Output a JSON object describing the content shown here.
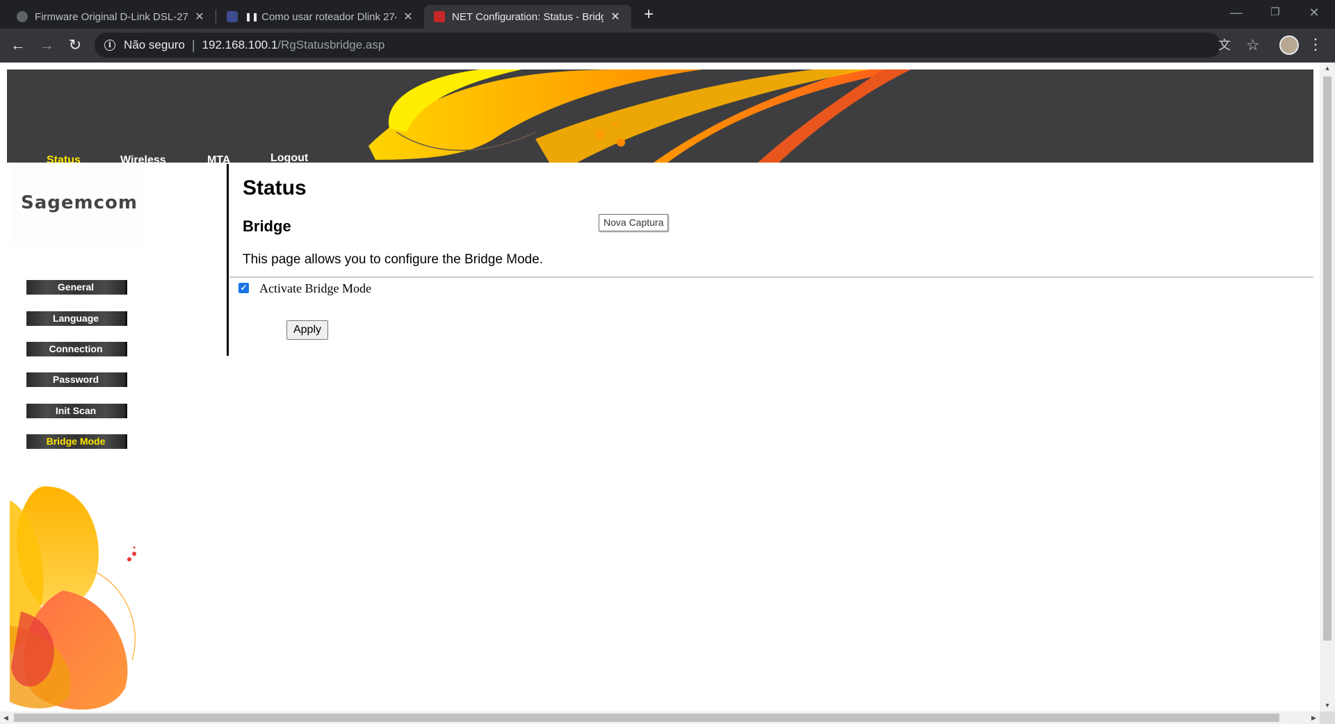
{
  "browser": {
    "tabs": [
      {
        "title": "Firmware Original D-Link DSL-27",
        "active": false
      },
      {
        "title": "Como usar roteador Dlink 274",
        "active": false
      },
      {
        "title": "NET Configuration: Status - Bridg",
        "active": true
      }
    ],
    "new_tab": "+",
    "window": {
      "minimize": "—",
      "restore": "❐",
      "close": "✕"
    },
    "nav": {
      "back": "←",
      "forward": "→",
      "reload": "↻"
    },
    "security_label": "Não seguro",
    "url_host": "192.168.100.1",
    "url_path": "/RgStatusbridge.asp",
    "translate_icon": "文",
    "bookmark_icon": "☆",
    "menu_icon": "⋮"
  },
  "topnav": [
    "Status",
    "Wireless",
    "MTA",
    "Logout"
  ],
  "logo": "Sagemcom",
  "sidebar": [
    "General",
    "Language",
    "Connection",
    "Password",
    "Init Scan",
    "Bridge Mode"
  ],
  "content": {
    "title": "Status",
    "subtitle": "Bridge",
    "description": "This page allows you to configure the Bridge Mode.",
    "checkbox_label": "Activate Bridge Mode",
    "checkbox_checked": true,
    "apply_label": "Apply",
    "tooltip": "Nova Captura"
  },
  "colors": {
    "accent_yellow": "#ffe600",
    "header_bg": "#3e3e40",
    "chrome_dark": "#202124",
    "checkbox_blue": "#1a73e8"
  }
}
